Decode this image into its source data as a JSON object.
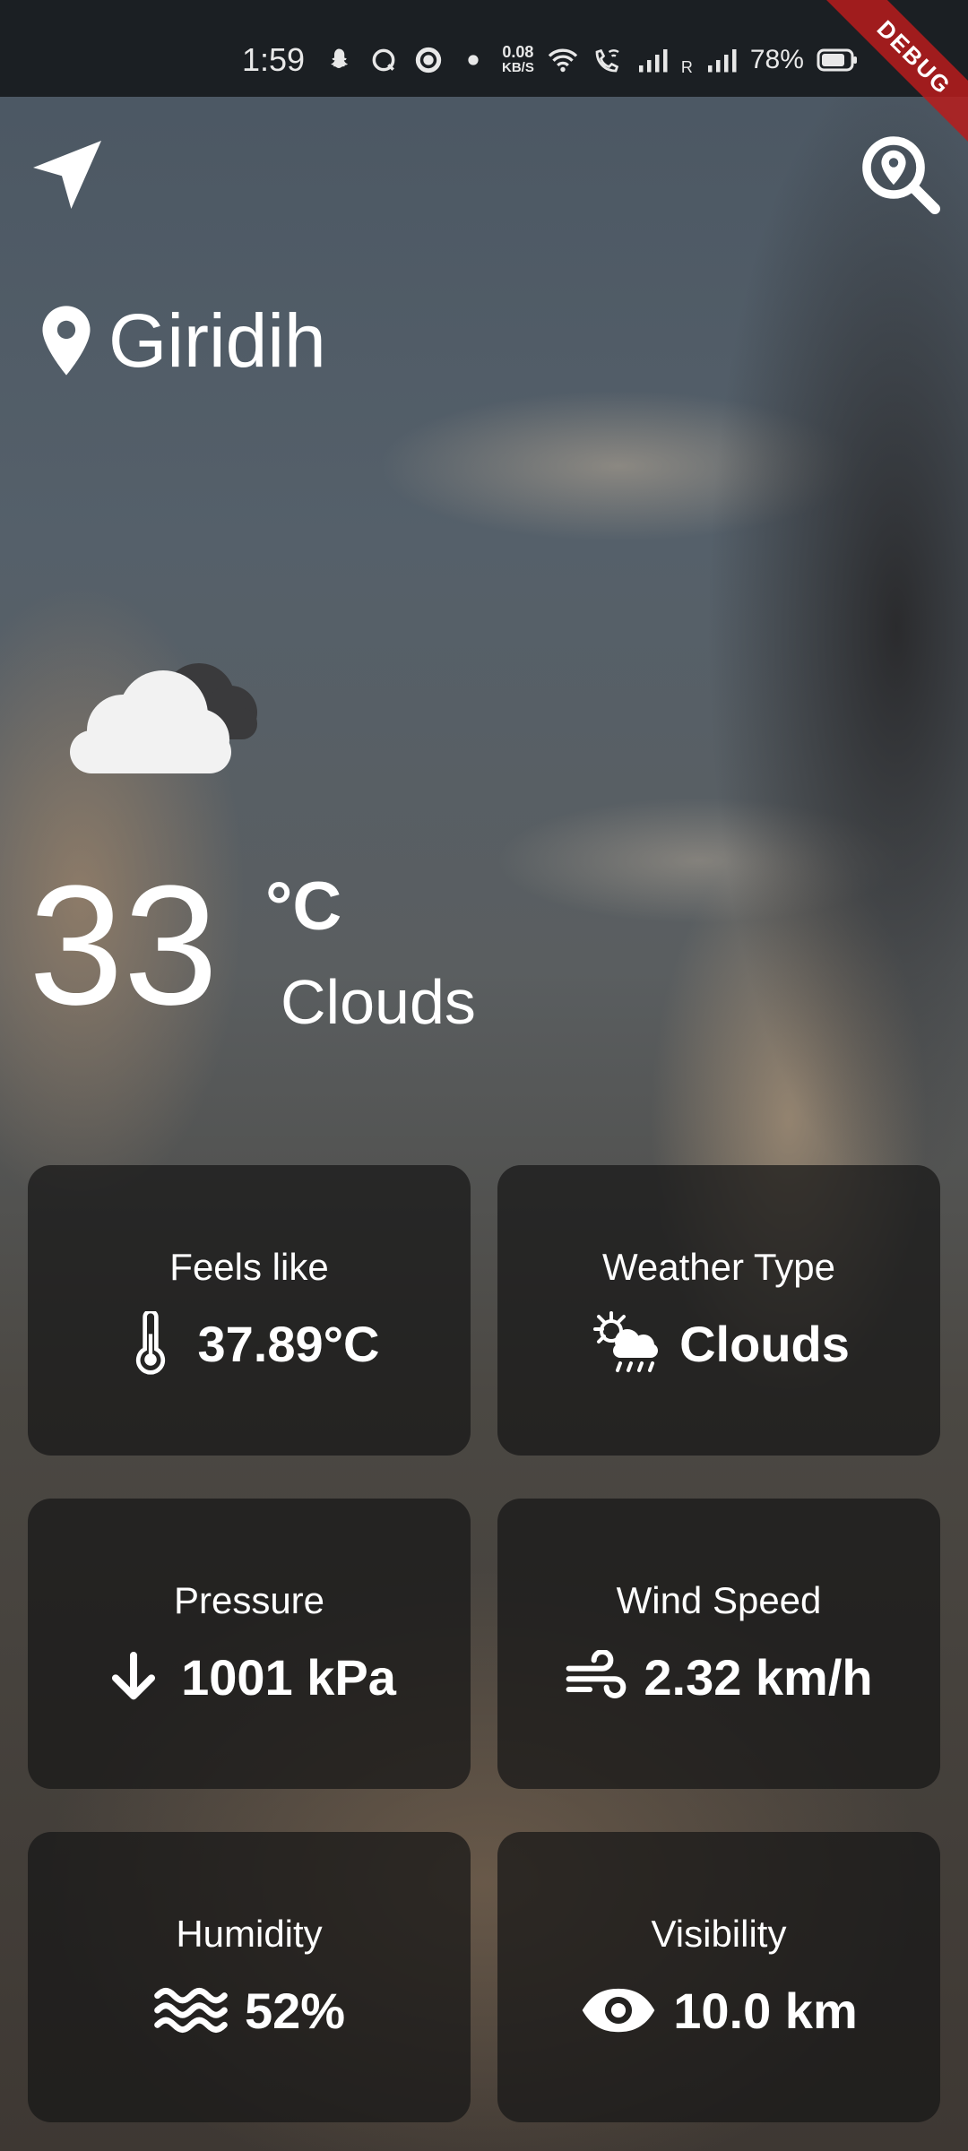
{
  "status_bar": {
    "time": "1:59",
    "net_speed_value": "0.08",
    "net_speed_unit": "KB/S",
    "roaming_indicator": "R",
    "battery": "78%"
  },
  "debug_banner": "DEBUG",
  "location": {
    "city": "Giridih"
  },
  "current": {
    "temperature": "33",
    "unit": "°C",
    "condition": "Clouds",
    "icon": "clouds-icon"
  },
  "cards": {
    "feels_like": {
      "label": "Feels like",
      "value": "37.89°C",
      "icon": "thermometer-icon"
    },
    "weather_type": {
      "label": "Weather Type",
      "value": "Clouds",
      "icon": "sun-cloud-rain-icon"
    },
    "pressure": {
      "label": "Pressure",
      "value": "1001 kPa",
      "icon": "arrow-down-icon"
    },
    "wind_speed": {
      "label": "Wind Speed",
      "value": "2.32 km/h",
      "icon": "wind-icon"
    },
    "humidity": {
      "label": "Humidity",
      "value": "52%",
      "icon": "water-waves-icon"
    },
    "visibility": {
      "label": "Visibility",
      "value": "10.0 km",
      "icon": "eye-icon"
    }
  }
}
